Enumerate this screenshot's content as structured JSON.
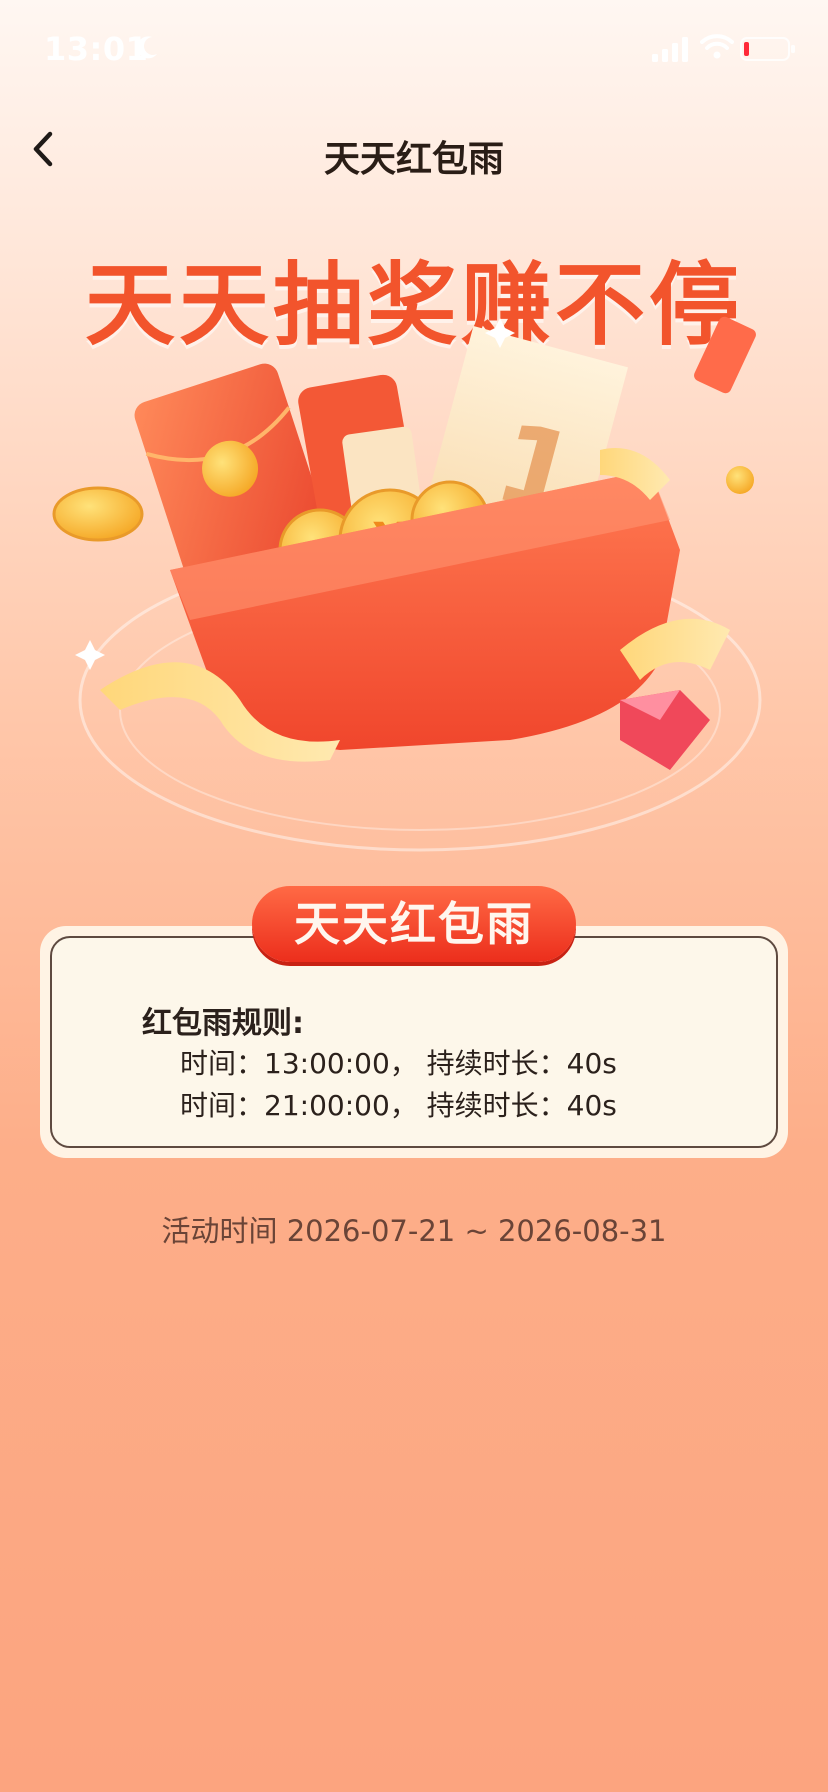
{
  "status_bar": {
    "time": "13:01",
    "icons": [
      "moon-icon",
      "signal-icon",
      "wifi-icon",
      "battery-icon"
    ]
  },
  "nav": {
    "back_icon": "chevron-left-icon",
    "title": "天天红包雨"
  },
  "headline": "天天抽奖赚不停",
  "illustration": {
    "description_icon": "red-envelope-gift-box-illustration"
  },
  "rules": {
    "badge": "天天红包雨",
    "title": "红包雨规则:",
    "lines": [
      "时间：13:00:00，  持续时长：40s",
      "时间：21:00:00，  持续时长：40s"
    ]
  },
  "activity": {
    "text": "活动时间 2026-07-21 ~ 2026-08-31"
  },
  "colors": {
    "headline": "#f2542c",
    "ribbon": "#ec2e1c",
    "card_bg": "#fdf7ea"
  }
}
